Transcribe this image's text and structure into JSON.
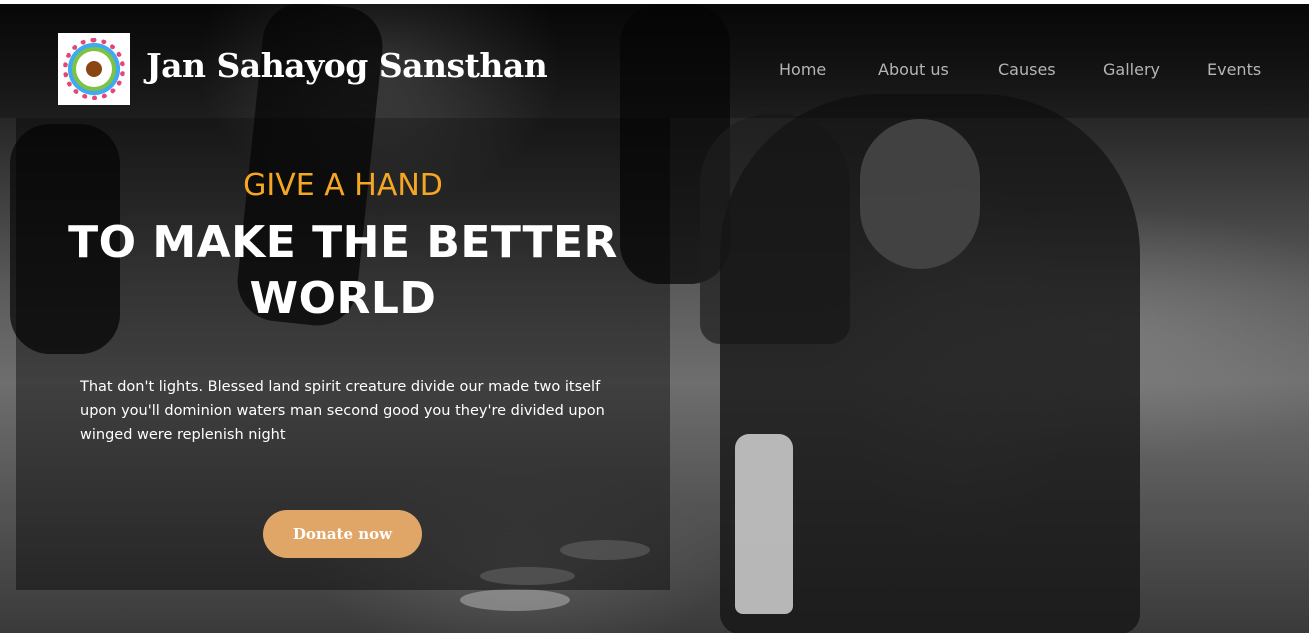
{
  "brand": {
    "name": "Jan Sahayog Sansthan"
  },
  "nav": {
    "items": [
      {
        "label": "Home"
      },
      {
        "label": "About us"
      },
      {
        "label": "Causes"
      },
      {
        "label": "Gallery"
      },
      {
        "label": "Events"
      }
    ]
  },
  "hero": {
    "eyebrow": "GIVE A HAND",
    "headline": "TO MAKE THE BETTER WORLD",
    "description": "That don't lights. Blessed land spirit creature divide our made two itself upon you'll dominion waters man second good you they're divided upon winged were replenish night",
    "cta_label": "Donate now"
  },
  "colors": {
    "accent": "#f5a623",
    "button": "#dfa668",
    "nav_text": "#b5b5b5"
  }
}
